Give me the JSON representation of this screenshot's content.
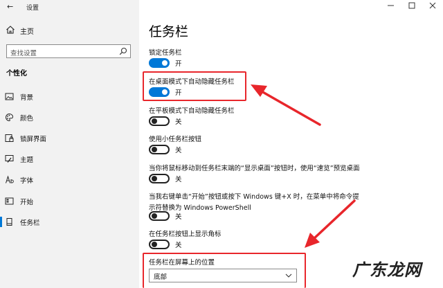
{
  "window": {
    "app_title": "设置",
    "back_glyph": "←",
    "controls": [
      "minimize",
      "maximize",
      "close"
    ]
  },
  "sidebar": {
    "home_label": "主页",
    "search_placeholder": "查找设置",
    "section_heading": "个性化",
    "items": [
      {
        "label": "背景",
        "icon": "image-icon",
        "active": false
      },
      {
        "label": "颜色",
        "icon": "palette-icon",
        "active": false
      },
      {
        "label": "锁屏界面",
        "icon": "lock-screen-icon",
        "active": false
      },
      {
        "label": "主题",
        "icon": "brush-icon",
        "active": false
      },
      {
        "label": "字体",
        "icon": "font-icon",
        "active": false
      },
      {
        "label": "开始",
        "icon": "start-menu-icon",
        "active": false
      },
      {
        "label": "任务栏",
        "icon": "taskbar-icon",
        "active": true
      }
    ]
  },
  "main": {
    "page_title": "任务栏",
    "settings": [
      {
        "title": "锁定任务栏",
        "on": true,
        "state": "开"
      },
      {
        "title": "在桌面模式下自动隐藏任务栏",
        "on": true,
        "state": "开",
        "highlighted": true
      },
      {
        "title": "在平板模式下自动隐藏任务栏",
        "on": false,
        "state": "关"
      },
      {
        "title": "使用小任务栏按钮",
        "on": false,
        "state": "关"
      },
      {
        "title": "当你将鼠标移动到任务栏末端的“显示桌面”按钮时，使用“速览”预览桌面",
        "on": false,
        "state": "关"
      },
      {
        "title_line1": "当我右键单击“开始”按钮或按下 Windows 键+X 时，在菜单中将命令提",
        "title_line2": "示符替换为 Windows PowerShell",
        "on": false,
        "state": "关"
      },
      {
        "title": "在任务栏按钮上显示角标",
        "on": false,
        "state": "关"
      }
    ],
    "position": {
      "title": "任务栏在屏幕上的位置",
      "selected": "底部",
      "highlighted": true
    }
  },
  "colors": {
    "accent": "#0078d7",
    "annotation_red": "#e8262b",
    "sidebar_bg": "#f2f2f2"
  },
  "watermark": "广东龙网"
}
